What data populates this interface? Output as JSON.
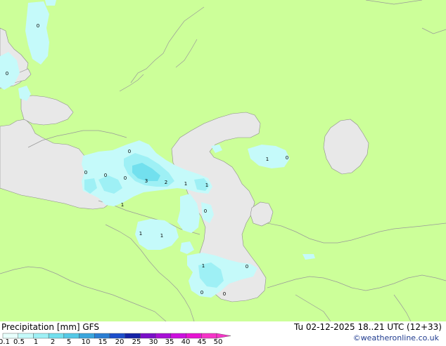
{
  "title": "Precipitation [mm] GFS",
  "valid_time": "Tu 02-12-2025 18..21 UTC (12+33)",
  "credit": "©weatheronline.co.uk",
  "legend": {
    "ticks": [
      "0.1",
      "0.5",
      "1",
      "2",
      "5",
      "10",
      "15",
      "20",
      "25",
      "30",
      "35",
      "40",
      "45",
      "50"
    ],
    "colors": [
      "#e8fffc",
      "#c5fafa",
      "#9ef0f5",
      "#72e0ee",
      "#55c9e6",
      "#3aa6dd",
      "#2a7ed3",
      "#1d4ecb",
      "#1422a6",
      "#7a0fc8",
      "#a710d6",
      "#cc10de",
      "#e614d2",
      "#f535c8"
    ]
  },
  "map": {
    "land_color": "#ccff99",
    "sea_color": "#e8e8e8",
    "border_color": "#999999",
    "coast_color": "#8c8c8c"
  },
  "point_values": [
    {
      "label": "0"
    },
    {
      "label": "0"
    },
    {
      "label": "0"
    },
    {
      "label": "0"
    },
    {
      "label": "0"
    },
    {
      "label": "3"
    },
    {
      "label": "2"
    },
    {
      "label": "1"
    },
    {
      "label": "1"
    },
    {
      "label": "1"
    },
    {
      "label": "0"
    },
    {
      "label": "1"
    },
    {
      "label": "0"
    },
    {
      "label": "0"
    },
    {
      "label": "1"
    },
    {
      "label": "1"
    },
    {
      "label": "0"
    },
    {
      "label": "0"
    },
    {
      "label": "0"
    },
    {
      "label": "1"
    }
  ]
}
